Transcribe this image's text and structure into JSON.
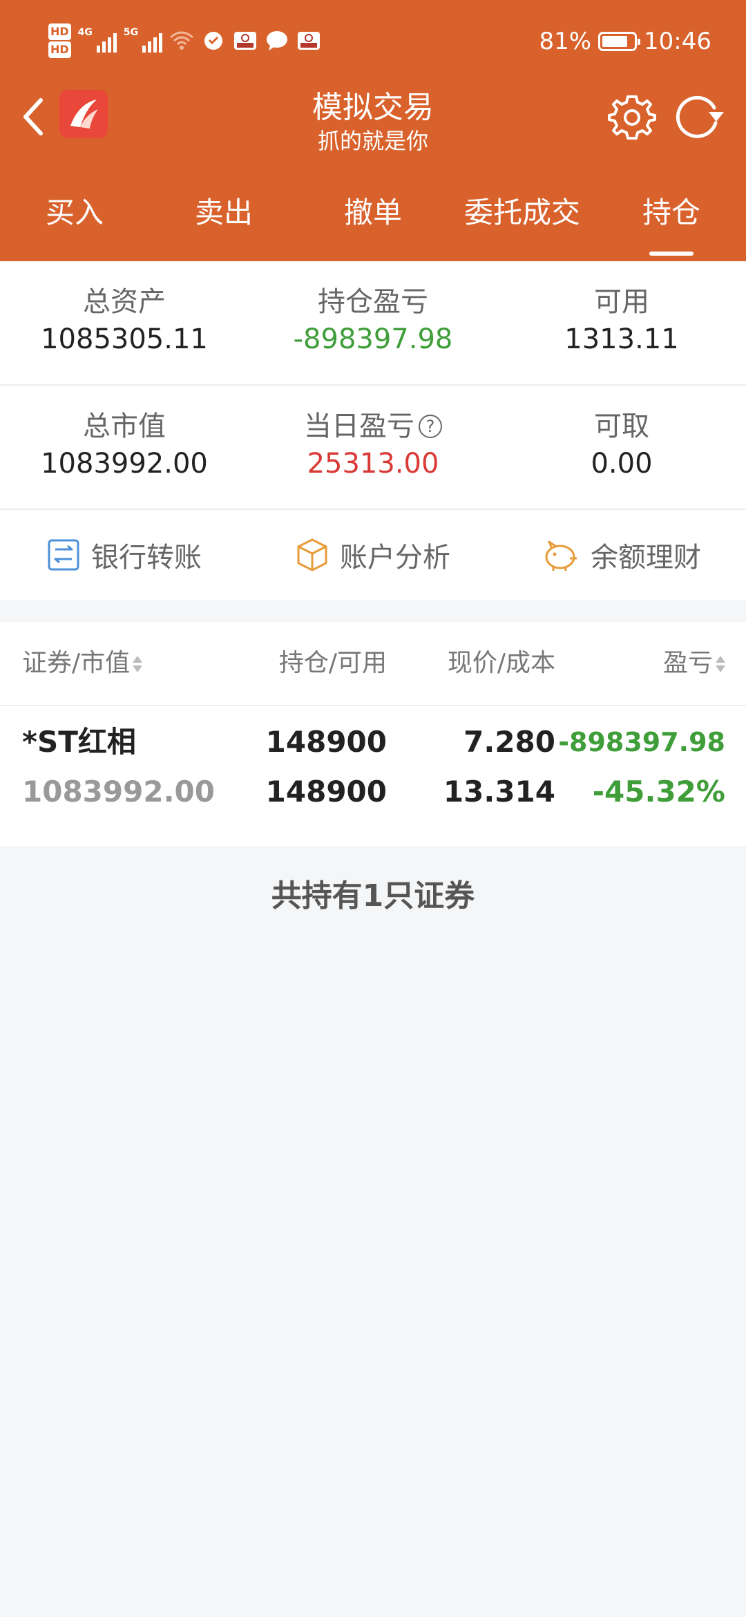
{
  "status_bar": {
    "hd1": "HD",
    "hd2": "HD",
    "net1": "4G",
    "net2": "5G",
    "battery_percent": "81%",
    "battery_level": 0.81,
    "time": "10:46"
  },
  "header": {
    "title": "模拟交易",
    "subtitle": "抓的就是你",
    "icons": [
      "back-arrow-icon",
      "app-logo",
      "settings-icon",
      "refresh-icon"
    ]
  },
  "tabs": [
    {
      "label": "买入",
      "active": false
    },
    {
      "label": "卖出",
      "active": false
    },
    {
      "label": "撤单",
      "active": false
    },
    {
      "label": "委托成交",
      "active": false
    },
    {
      "label": "持仓",
      "active": true
    }
  ],
  "summary": {
    "total_assets": {
      "label": "总资产",
      "value": "1085305.11"
    },
    "position_pnl": {
      "label": "持仓盈亏",
      "value": "-898397.98"
    },
    "available": {
      "label": "可用",
      "value": "1313.11"
    },
    "market_value": {
      "label": "总市值",
      "value": "1083992.00"
    },
    "daily_pnl": {
      "label": "当日盈亏",
      "value": "25313.00",
      "help": "?"
    },
    "withdrawable": {
      "label": "可取",
      "value": "0.00"
    }
  },
  "actions": [
    {
      "label": "银行转账",
      "icon": "bank-transfer-icon"
    },
    {
      "label": "账户分析",
      "icon": "box-icon"
    },
    {
      "label": "余额理财",
      "icon": "piggy-bank-icon"
    }
  ],
  "holdings": {
    "columns": [
      "证券/市值",
      "持仓/可用",
      "现价/成本",
      "盈亏"
    ],
    "rows": [
      {
        "name": "*ST红相",
        "market_value": "1083992.00",
        "position": "148900",
        "available": "148900",
        "price": "7.280",
        "cost": "13.314",
        "pnl": "-898397.98",
        "pnl_pct": "-45.32%"
      }
    ],
    "count_text": "共持有1只证券"
  },
  "colors": {
    "brand": "#d9612b",
    "loss_green": "#3f9e3a",
    "gain_red": "#d93a36"
  }
}
